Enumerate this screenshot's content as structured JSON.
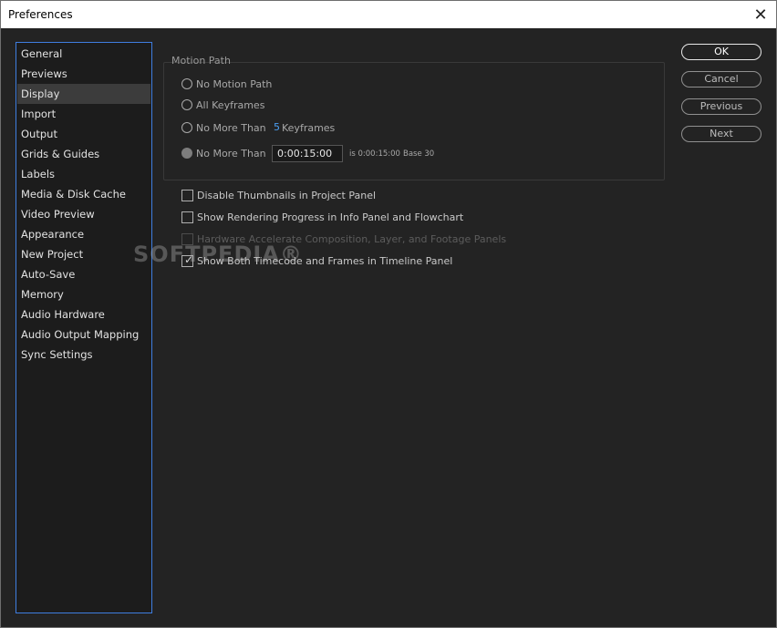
{
  "window": {
    "title": "Preferences"
  },
  "sidebar": {
    "items": [
      {
        "label": "General"
      },
      {
        "label": "Previews"
      },
      {
        "label": "Display",
        "selected": true
      },
      {
        "label": "Import"
      },
      {
        "label": "Output"
      },
      {
        "label": "Grids & Guides"
      },
      {
        "label": "Labels"
      },
      {
        "label": "Media & Disk Cache"
      },
      {
        "label": "Video Preview"
      },
      {
        "label": "Appearance"
      },
      {
        "label": "New Project"
      },
      {
        "label": "Auto-Save"
      },
      {
        "label": "Memory"
      },
      {
        "label": "Audio Hardware"
      },
      {
        "label": "Audio Output Mapping"
      },
      {
        "label": "Sync Settings"
      }
    ]
  },
  "motion_path": {
    "title": "Motion Path",
    "options": {
      "none": "No Motion Path",
      "all": "All Keyframes",
      "max_keyframes": "No More Than",
      "max_time": "No More Than"
    },
    "selected_option": "max_time",
    "keyframes_value": "5",
    "keyframes_unit": "Keyframes",
    "timecode_value": "0:00:15:00",
    "timecode_note": "is 0:00:15:00",
    "base_note": "Base 30"
  },
  "checkboxes": [
    {
      "label": "Disable Thumbnails in Project Panel",
      "checked": false,
      "enabled": true
    },
    {
      "label": "Show Rendering Progress in Info Panel and Flowchart",
      "checked": false,
      "enabled": true
    },
    {
      "label": "Hardware Accelerate Composition, Layer, and Footage Panels",
      "checked": false,
      "enabled": false
    },
    {
      "label": "Show Both Timecode and Frames in Timeline Panel",
      "checked": true,
      "enabled": true
    }
  ],
  "buttons": {
    "ok": "OK",
    "cancel": "Cancel",
    "previous": "Previous",
    "next": "Next"
  },
  "icons": {
    "close": "close-icon",
    "check": "check-icon"
  },
  "colors": {
    "accent": "#3f7ee0",
    "value_blue": "#4a9ef2",
    "background": "#232323"
  },
  "watermark": "SOFTPEDIA®"
}
